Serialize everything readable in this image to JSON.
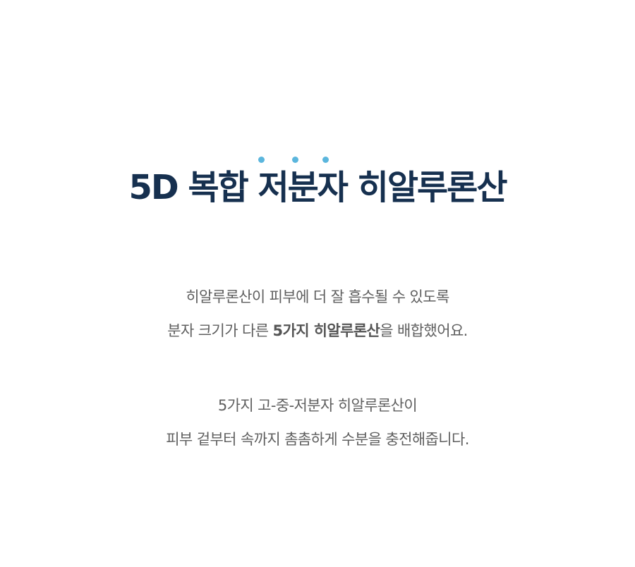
{
  "decoration": {
    "dots": [
      "dot",
      "dot",
      "dot"
    ],
    "dot_color": "#5bb6dd"
  },
  "title": "5D 복합 저분자 히알루론산",
  "title_color": "#16304f",
  "paragraph1": {
    "line1": "히알루론산이 피부에 더 잘 흡수될 수 있도록",
    "line2_prefix": "분자 크기가 다른 ",
    "line2_bold": "5가지 히알루론산",
    "line2_suffix": "을 배합했어요."
  },
  "paragraph2": {
    "line1": "5가지 고-중-저분자 히알루론산이",
    "line2": "피부 겉부터 속까지 촘촘하게 수분을 충전해줍니다."
  },
  "text_color": "#5f5f5f"
}
